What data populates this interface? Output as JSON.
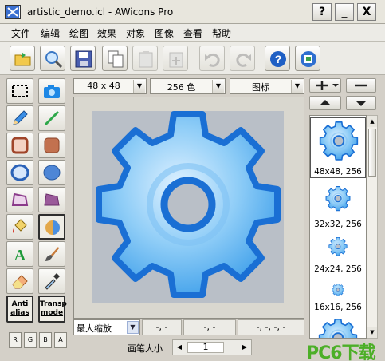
{
  "window": {
    "title": "artistic_demo.icl - AWicons Pro",
    "buttons": {
      "help": "?",
      "minimize": "_",
      "close": "X"
    }
  },
  "menu": [
    "文件",
    "编辑",
    "绘图",
    "效果",
    "对象",
    "图像",
    "查看",
    "帮助"
  ],
  "toolbar": {
    "items": [
      "open-icon",
      "zoom-icon",
      "save-icon",
      "copy-icon",
      "paste-icon",
      "paste-new-icon",
      "undo-icon",
      "redo-icon",
      "help-icon",
      "preview-icon"
    ]
  },
  "tools": {
    "antialias_label": "Anti alias",
    "transparent_label": "Transp mode",
    "channels": [
      "R",
      "G",
      "B",
      "A"
    ]
  },
  "format_bar": {
    "size": "48 x 48",
    "colors": "256 色",
    "type": "图标"
  },
  "status": {
    "zoom": "最大缩放",
    "pos1": "-, -",
    "pos2": "-, -",
    "pos3": "-, -, -, -",
    "pen_label": "画笔大小",
    "pen_size": "1"
  },
  "previews": [
    {
      "caption": "48x48, 256",
      "selected": true
    },
    {
      "caption": "32x32, 256",
      "selected": false
    },
    {
      "caption": "24x24, 256",
      "selected": false
    },
    {
      "caption": "16x16, 256",
      "selected": false
    }
  ],
  "watermark": "PC6下载",
  "colors": {
    "gear_dark": "#1a6fd4",
    "gear_light": "#7fc4f4",
    "canvas_bg": "#b9bfc7"
  }
}
